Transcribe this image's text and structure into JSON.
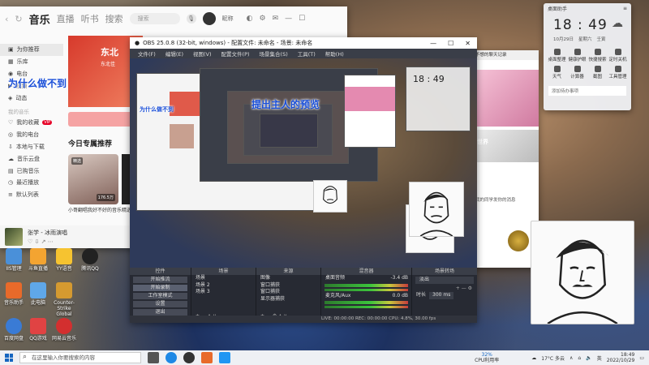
{
  "music": {
    "nav_back": "‹",
    "nav_refresh": "↻",
    "tabs": [
      "音乐",
      "直播",
      "听书",
      "搜索"
    ],
    "search_placeholder": "搜索",
    "user_name": "昵称",
    "sidebar": [
      {
        "label": "为你推荐",
        "active": true
      },
      {
        "label": "乐库"
      },
      {
        "label": "电台"
      },
      {
        "label": "视频"
      },
      {
        "label": "动态"
      }
    ],
    "sidebar_section": "我的音乐",
    "sidebar2": [
      "我的收藏",
      "我的电台",
      "本地与下载",
      "音乐云盘",
      "已购音乐",
      "最近播放",
      "默认列表"
    ],
    "badge": "VIP",
    "banner_text": "东北",
    "banner_sub": "东北佳",
    "rec_heading": "今日专属推荐",
    "rec_tag": "精选",
    "rec_count": "176.5万",
    "rec_title": "小哥翻唱我好不好的音乐",
    "rec_title2": "精选",
    "player_song": "张学 - 冰雨演唱"
  },
  "desktop_icons": [
    {
      "label": "IIS管理",
      "color": "#4a90d9"
    },
    {
      "label": "斗鱼直播",
      "color": "#f3a431"
    },
    {
      "label": "YY语音",
      "color": "#f6c330"
    },
    {
      "label": "腾讯QQ",
      "color": "#222"
    },
    {
      "label": "音乐助手",
      "color": "#e86a2a"
    },
    {
      "label": "此电脑",
      "color": "#5fa7e8"
    },
    {
      "label": "Counter-Strike Global",
      "color": "#d59a30"
    },
    {
      "label": "百度网盘",
      "color": "#3a7bd5"
    },
    {
      "label": "QQ游戏",
      "color": "#e04343"
    },
    {
      "label": "网易云音乐",
      "color": "#d32f2f"
    }
  ],
  "obs": {
    "title": "OBS 25.0.8 (32-bit, windows) - 配置文件: 未命名 - 场景: 未命名",
    "menu": [
      "文件(F)",
      "编辑(E)",
      "视图(V)",
      "配置文件(P)",
      "场景集合(S)",
      "工具(T)",
      "帮助(H)"
    ],
    "docks": {
      "controls": {
        "title": "控件",
        "buttons": [
          "开始推流",
          "开始录制",
          "工作室模式",
          "设置",
          "退出"
        ]
      },
      "scenes": {
        "title": "场景",
        "items": [
          "场景",
          "场景 2",
          "场景 3"
        ]
      },
      "sources": {
        "title": "来源",
        "items": [
          "图像",
          "窗口捕获",
          "窗口捕获",
          "显示器捕获"
        ]
      },
      "mixer": {
        "title": "混音器",
        "ch1": "桌面音频",
        "ch1_db": "-3.4 dB",
        "ch2": "麦克风/Aux",
        "ch2_db": "0.0 dB"
      },
      "transitions": {
        "title": "场景转场",
        "type": "淡出",
        "duration_label": "时长",
        "duration": "300 ms"
      }
    },
    "status": "LIVE: 00:00:00   REC: 00:00:00   CPU: 4.8%, 30.00 fps"
  },
  "overlay": {
    "music_big": "为什么做不到",
    "obs_mid": "提出主人的预览",
    "obs_small": "为什么做不到"
  },
  "chat": {
    "title": "不想的聊天记录",
    "bottom_msg": "我的同学发你的消息",
    "tab_label": "世界"
  },
  "clock": {
    "title": "桌面助手",
    "time": "18 : 49",
    "date": "10月29日",
    "weekday": "星期六",
    "lunar": "壬寅",
    "tools": [
      "桌面整理",
      "健康护眼",
      "快捷搜索",
      "定时关机",
      "天气",
      "计算器",
      "截图",
      "工具管理"
    ],
    "todo": "添加待办事项"
  },
  "taskbar": {
    "search_placeholder": "在这里输入你要搜索的内容",
    "cpu": "32%",
    "cpu_label": "CPU利用率",
    "weather": "17°C 多云",
    "lang": "英",
    "time": "18:49",
    "date": "2022/10/29"
  },
  "colors": {
    "accent_red": "#e60026",
    "obs_bg": "#2b2e38",
    "overlay_blue": "#1a4fd8"
  }
}
